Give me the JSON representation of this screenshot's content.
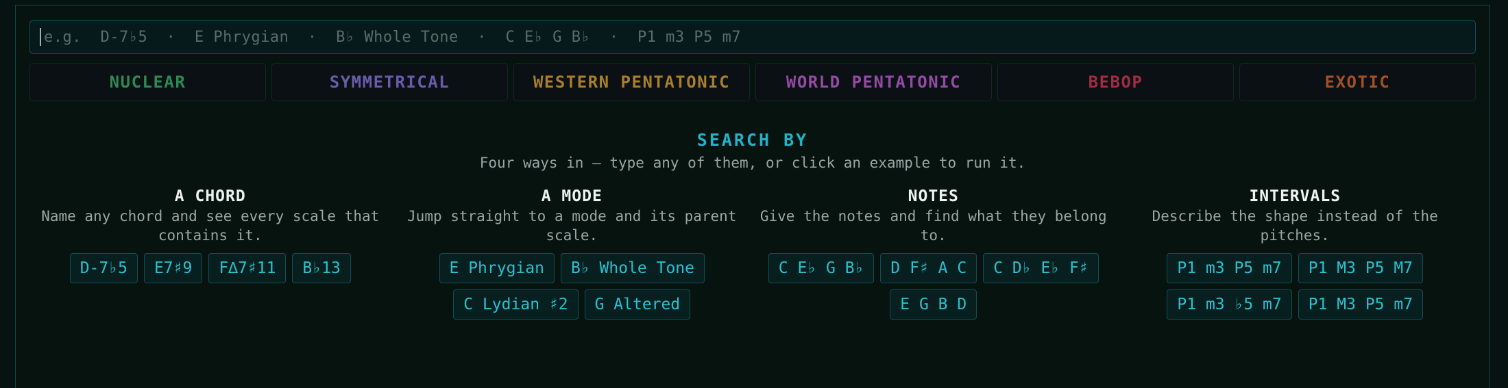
{
  "search": {
    "placeholder": "e.g.  D-7♭5  ·  E Phrygian  ·  B♭ Whole Tone  ·  C E♭ G B♭  ·  P1 m3 P5 m7",
    "value": ""
  },
  "categories": [
    {
      "label": "NUCLEAR",
      "color": "#2e8a55"
    },
    {
      "label": "SYMMETRICAL",
      "color": "#6a5cab"
    },
    {
      "label": "WESTERN PENTATONIC",
      "color": "#a87f2a"
    },
    {
      "label": "WORLD PENTATONIC",
      "color": "#954aa5"
    },
    {
      "label": "BEBOP",
      "color": "#a32b43"
    },
    {
      "label": "EXOTIC",
      "color": "#a54f24"
    }
  ],
  "search_by": {
    "title": "SEARCH BY",
    "subtitle": "Four ways in — type any of them, or click an example to run it.",
    "sections": [
      {
        "title": "A CHORD",
        "description": "Name any chord and see every scale that contains it.",
        "examples": [
          "D-7♭5",
          "E7♯9",
          "F∆7♯11",
          "B♭13"
        ]
      },
      {
        "title": "A MODE",
        "description": "Jump straight to a mode and its parent scale.",
        "examples": [
          "E Phrygian",
          "B♭ Whole Tone",
          "C Lydian ♯2",
          "G Altered"
        ]
      },
      {
        "title": "NOTES",
        "description": "Give the notes and find what they belong to.",
        "examples": [
          "C E♭ G B♭",
          "D F♯ A C",
          "C D♭ E♭ F♯",
          "E G B D"
        ]
      },
      {
        "title": "INTERVALS",
        "description": "Describe the shape instead of the pitches.",
        "examples": [
          "P1 m3 P5 m7",
          "P1 M3 P5 M7",
          "P1 m3 ♭5 m7",
          "P1 M3 P5 m7"
        ]
      }
    ]
  }
}
